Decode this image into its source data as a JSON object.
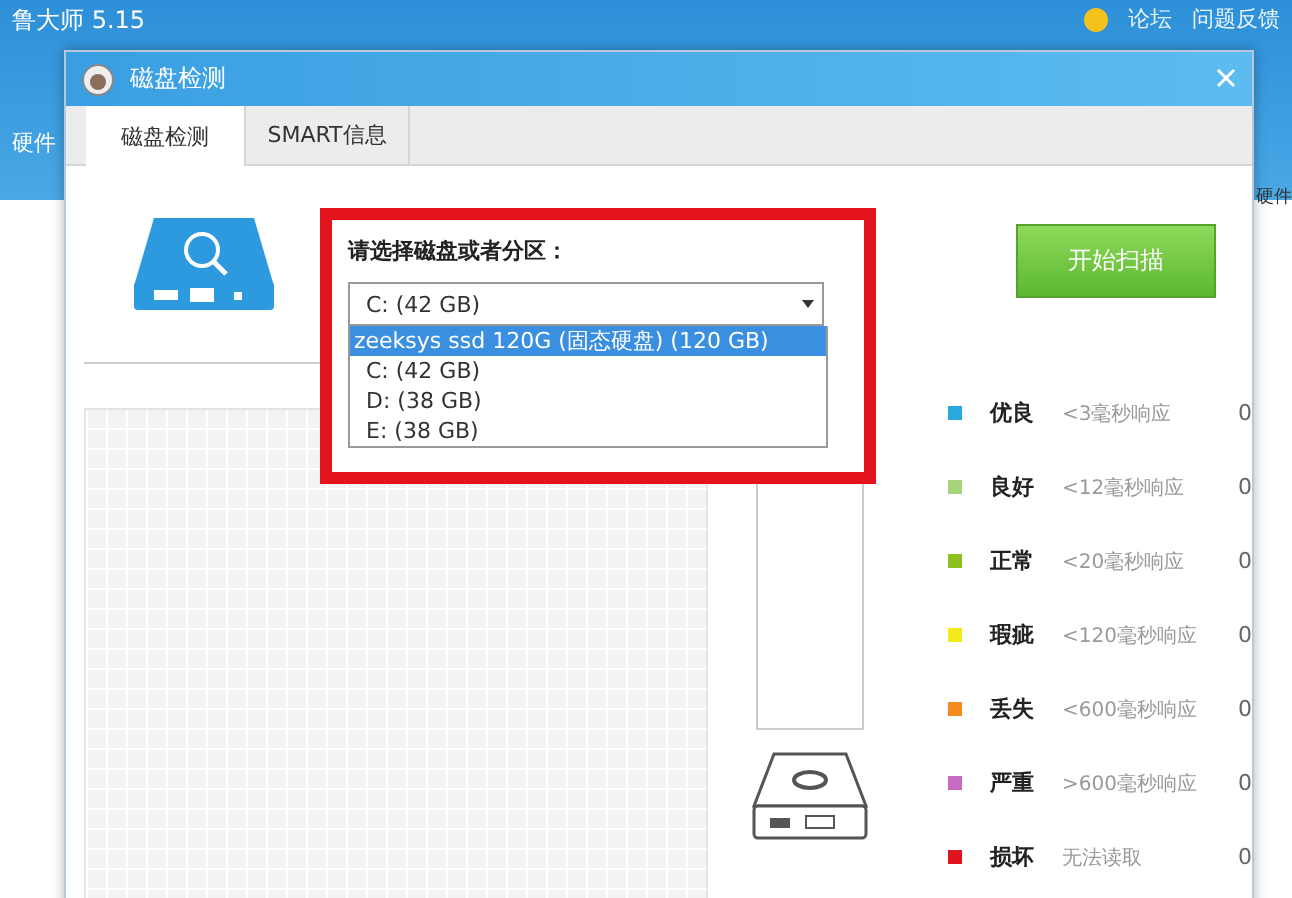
{
  "app": {
    "title": "鲁大师 5.15",
    "links": [
      "论坛",
      "问题反馈"
    ],
    "left_label": "硬件",
    "right_label": "硬件"
  },
  "dialog": {
    "title": "磁盘检测",
    "tabs": [
      {
        "label": "磁盘检测",
        "selected": true
      },
      {
        "label": "SMART信息",
        "selected": false
      }
    ],
    "select": {
      "label": "请选择磁盘或者分区：",
      "value": "C:  (42 GB)",
      "options": [
        {
          "label": "zeeksys ssd 120G (固态硬盘)  (120 GB)",
          "highlighted": true
        },
        {
          "label": "C:  (42 GB)",
          "highlighted": false
        },
        {
          "label": "D:  (38 GB)",
          "highlighted": false
        },
        {
          "label": "E:  (38 GB)",
          "highlighted": false
        }
      ]
    },
    "start_button": "开始扫描",
    "legend": [
      {
        "color": "#29a8e0",
        "label": "优良",
        "desc": "<3毫秒响应",
        "count": "0"
      },
      {
        "color": "#a6d47a",
        "label": "良好",
        "desc": "<12毫秒响应",
        "count": "0"
      },
      {
        "color": "#8cbf1f",
        "label": "正常",
        "desc": "<20毫秒响应",
        "count": "0"
      },
      {
        "color": "#f2e81a",
        "label": "瑕疵",
        "desc": "<120毫秒响应",
        "count": "0"
      },
      {
        "color": "#f58a1f",
        "label": "丢失",
        "desc": "<600毫秒响应",
        "count": "0"
      },
      {
        "color": "#c86bc0",
        "label": "严重",
        "desc": ">600毫秒响应",
        "count": "0"
      },
      {
        "color": "#e0141e",
        "label": "损坏",
        "desc": "无法读取",
        "count": "0"
      }
    ]
  }
}
